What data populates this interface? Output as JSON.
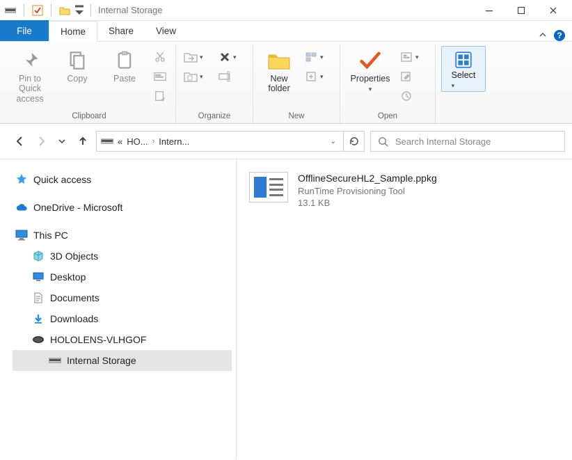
{
  "window": {
    "title": "Internal Storage"
  },
  "tabs": {
    "file": "File",
    "home": "Home",
    "share": "Share",
    "view": "View"
  },
  "ribbon": {
    "clipboard": {
      "label": "Clipboard",
      "pin": "Pin to Quick access",
      "copy": "Copy",
      "paste": "Paste"
    },
    "organize": {
      "label": "Organize"
    },
    "new": {
      "label": "New",
      "new_folder": "New folder"
    },
    "open": {
      "label": "Open",
      "properties": "Properties"
    },
    "select": {
      "label": "Select"
    }
  },
  "nav": {
    "crumb_prefix": "«",
    "crumb1": "HO...",
    "crumb2": "Intern...",
    "search_placeholder": "Search Internal Storage"
  },
  "tree": {
    "quick_access": "Quick access",
    "onedrive": "OneDrive - Microsoft",
    "this_pc": "This PC",
    "objects3d": "3D Objects",
    "desktop": "Desktop",
    "documents": "Documents",
    "downloads": "Downloads",
    "hololens": "HOLOLENS-VLHGOF",
    "internal_storage": "Internal Storage"
  },
  "file": {
    "name": "OfflineSecureHL2_Sample.ppkg",
    "type": "RunTime Provisioning Tool",
    "size": "13.1 KB"
  }
}
